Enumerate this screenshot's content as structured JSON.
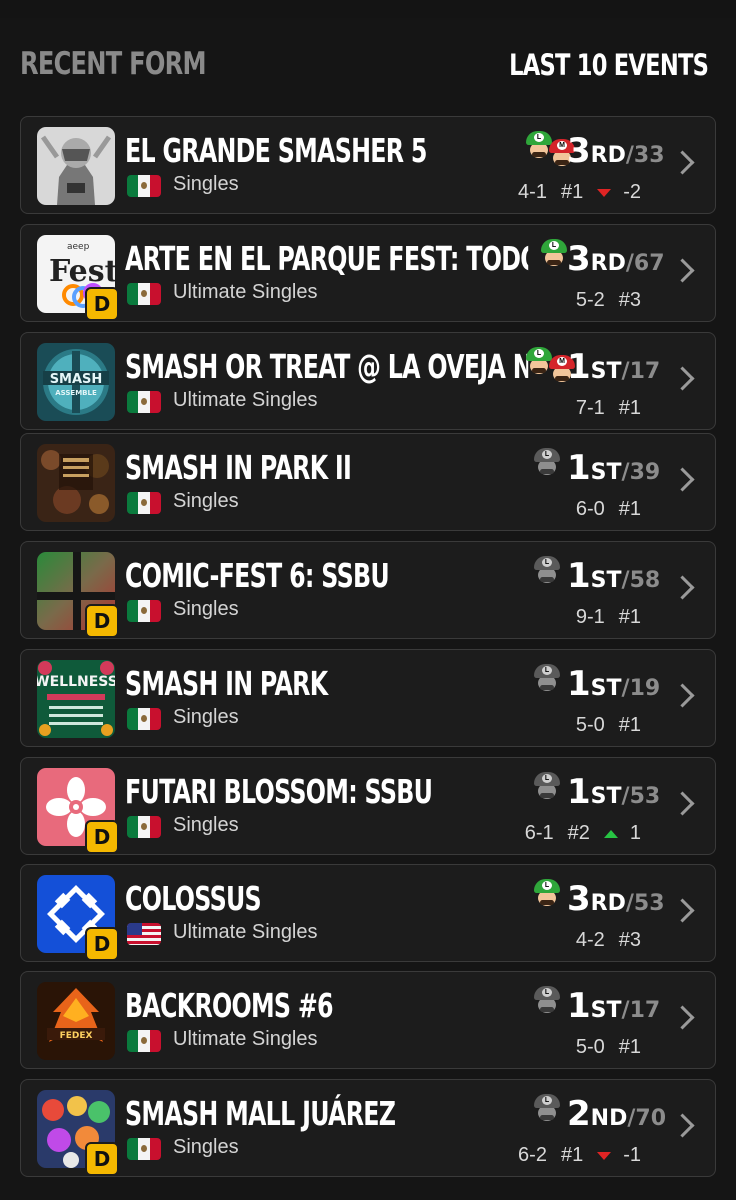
{
  "header": {
    "title": "RECENT FORM",
    "subtitle": "LAST 10 EVENTS"
  },
  "events": [
    {
      "name": "EL GRANDE SMASHER 5",
      "type": "Singles",
      "flag": "mexico",
      "place": "3",
      "suffix": "RD",
      "total": "/33",
      "record": "4-1",
      "seed": "#1",
      "trend": "down",
      "trend_value": "-2",
      "verified": false,
      "characters": [
        "luigi",
        "mario"
      ]
    },
    {
      "name": "ARTE EN EL PARQUE FEST: TODOS ...",
      "type": "Ultimate Singles",
      "flag": "mexico",
      "place": "3",
      "suffix": "RD",
      "total": "/67",
      "record": "5-2",
      "seed": "#3",
      "trend": "",
      "trend_value": "",
      "verified": true,
      "characters": [
        "luigi"
      ]
    },
    {
      "name": "SMASH OR TREAT @ LA OVEJA NEGRA",
      "type": "Ultimate Singles",
      "flag": "mexico",
      "place": "1",
      "suffix": "ST",
      "total": "/17",
      "record": "7-1",
      "seed": "#1",
      "trend": "",
      "trend_value": "",
      "verified": false,
      "characters": [
        "luigi",
        "mario"
      ]
    },
    {
      "name": "SMASH IN PARK II",
      "type": "Singles",
      "flag": "mexico",
      "place": "1",
      "suffix": "ST",
      "total": "/39",
      "record": "6-0",
      "seed": "#1",
      "trend": "",
      "trend_value": "",
      "verified": false,
      "characters": [
        "gray"
      ]
    },
    {
      "name": "COMIC-FEST 6: SSBU",
      "type": "Singles",
      "flag": "mexico",
      "place": "1",
      "suffix": "ST",
      "total": "/58",
      "record": "9-1",
      "seed": "#1",
      "trend": "",
      "trend_value": "",
      "verified": true,
      "characters": [
        "gray"
      ]
    },
    {
      "name": "SMASH IN PARK",
      "type": "Singles",
      "flag": "mexico",
      "place": "1",
      "suffix": "ST",
      "total": "/19",
      "record": "5-0",
      "seed": "#1",
      "trend": "",
      "trend_value": "",
      "verified": false,
      "characters": [
        "gray"
      ]
    },
    {
      "name": "FUTARI BLOSSOM: SSBU",
      "type": "Singles",
      "flag": "mexico",
      "place": "1",
      "suffix": "ST",
      "total": "/53",
      "record": "6-1",
      "seed": "#2",
      "trend": "up",
      "trend_value": "1",
      "verified": true,
      "characters": [
        "gray"
      ]
    },
    {
      "name": "COLOSSUS",
      "type": "Ultimate Singles",
      "flag": "usa",
      "place": "3",
      "suffix": "RD",
      "total": "/53",
      "record": "4-2",
      "seed": "#3",
      "trend": "",
      "trend_value": "",
      "verified": true,
      "characters": [
        "luigi"
      ]
    },
    {
      "name": "BACKROOMS #6",
      "type": "Ultimate Singles",
      "flag": "mexico",
      "place": "1",
      "suffix": "ST",
      "total": "/17",
      "record": "5-0",
      "seed": "#1",
      "trend": "",
      "trend_value": "",
      "verified": false,
      "characters": [
        "gray"
      ]
    },
    {
      "name": "SMASH MALL JUÁREZ",
      "type": "Singles",
      "flag": "mexico",
      "place": "2",
      "suffix": "ND",
      "total": "/70",
      "record": "6-2",
      "seed": "#1",
      "trend": "down",
      "trend_value": "-1",
      "verified": true,
      "characters": [
        "gray"
      ]
    }
  ],
  "badge_letter": "D",
  "thumb_text": {
    "fest_top": "aeep",
    "fest_main": "F st",
    "smash_assemble_1": "SMASH",
    "smash_assemble_2": "ASSEMBLE",
    "wellness": "WELLNESS",
    "backrooms": "FEDEX"
  },
  "colors": {
    "badge": "#f5b800",
    "trend_up": "#27c443",
    "trend_down": "#e02424"
  }
}
